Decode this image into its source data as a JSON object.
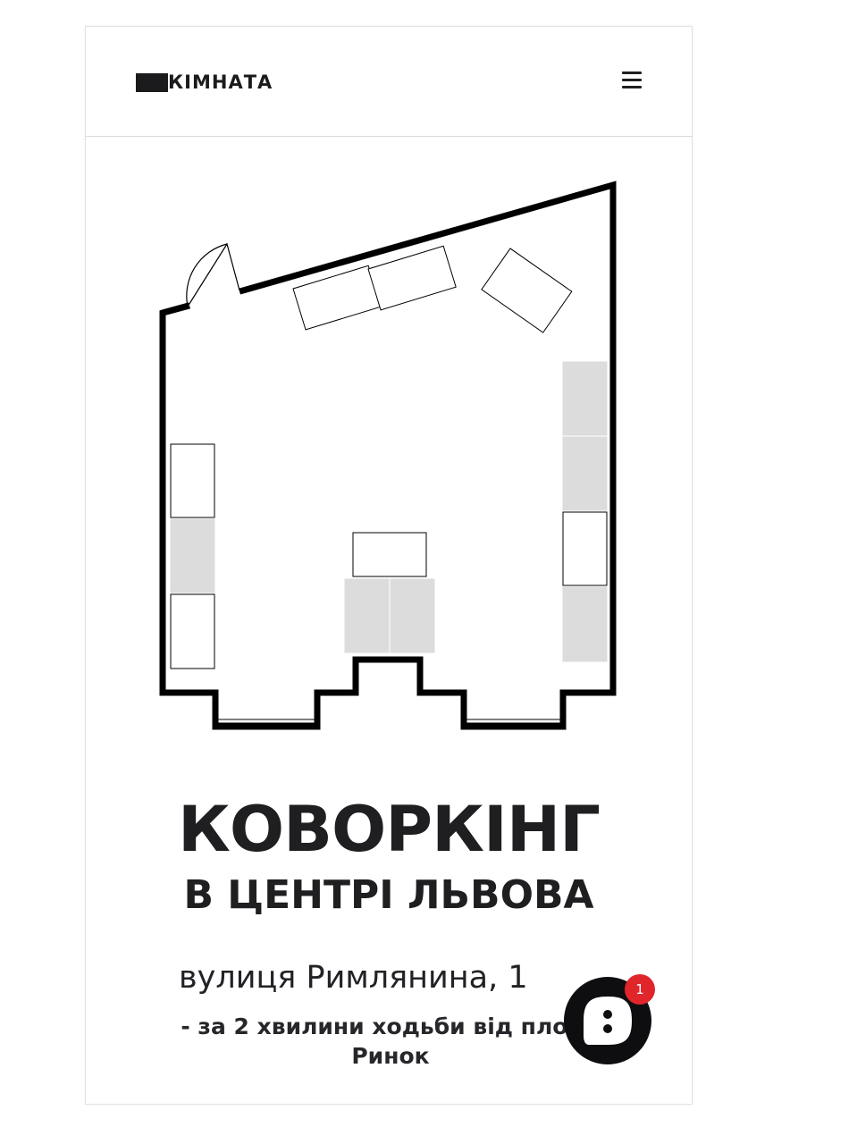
{
  "header": {
    "logo_text": "КIМНАТА",
    "menu_icon": "hamburger-menu-icon"
  },
  "hero": {
    "title": "КОВОРКІНГ",
    "subtitle": "В ЦЕНТРІ ЛЬВОВА",
    "address": "вулиця Римлянина, 1",
    "walk_text": "- за 2 хвилини ходьби від площі Ринок"
  },
  "chat": {
    "icon": "chat-bubble-icon",
    "badge_count": "1"
  },
  "colors": {
    "text": "#1f1f22",
    "wall": "#000000",
    "furniture_fill": "#dcdcdc",
    "badge": "#e0262b",
    "chat_bg": "#0e0e10"
  }
}
